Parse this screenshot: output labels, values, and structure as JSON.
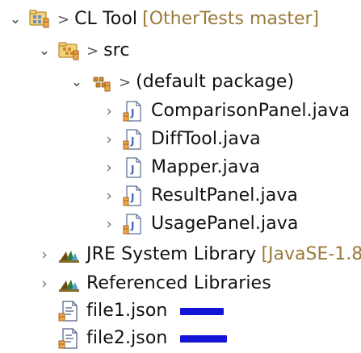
{
  "project": {
    "name": "CL Tool",
    "decoration": "[OtherTests master]",
    "decoration_color": "#9b7a3a"
  },
  "nodes": [
    {
      "label": "src",
      "icon": "package-folder-icon"
    },
    {
      "label": "(default package)",
      "icon": "package-icon"
    },
    {
      "label": "ComparisonPanel.java",
      "icon": "java-file-icon"
    },
    {
      "label": "DiffTool.java",
      "icon": "java-file-icon"
    },
    {
      "label": "Mapper.java",
      "icon": "java-file-icon"
    },
    {
      "label": "ResultPanel.java",
      "icon": "java-file-icon"
    },
    {
      "label": "UsagePanel.java",
      "icon": "java-file-icon"
    },
    {
      "label": "JRE System Library",
      "decoration": "[JavaSE-1.8]",
      "icon": "library-icon"
    },
    {
      "label": "Referenced Libraries",
      "icon": "library-icon"
    },
    {
      "label": "file1.json",
      "icon": "json-file-icon"
    },
    {
      "label": "file2.json",
      "icon": "json-file-icon"
    }
  ],
  "markers": {
    "expanded": "v",
    "collapsed": ">",
    "prefix": ">"
  },
  "colors": {
    "redaction": "#1515d8",
    "text": "#111111",
    "decoration": "#9b7a3a"
  }
}
